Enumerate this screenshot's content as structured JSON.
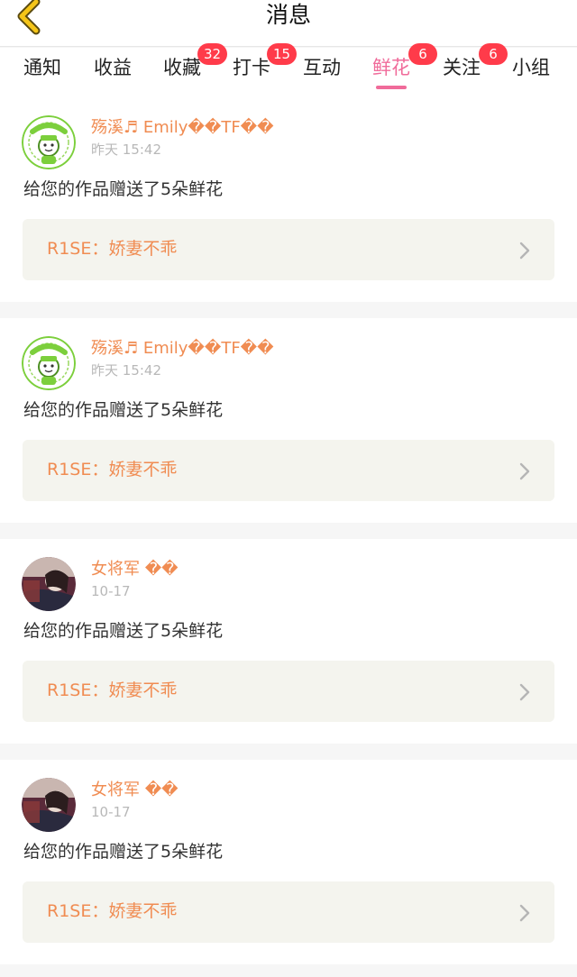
{
  "header": {
    "title": "消息",
    "back_icon": "chevron-left-icon"
  },
  "colors": {
    "accent_pink": "#f06b9a",
    "badge_red": "#ff3b4a",
    "name_orange": "#f08c52",
    "back_yellow": "#f5c518",
    "work_bg": "#f4f4ee"
  },
  "tabs": [
    {
      "label": "通知",
      "badge": ""
    },
    {
      "label": "收益",
      "badge": ""
    },
    {
      "label": "收藏",
      "badge": "32"
    },
    {
      "label": "打卡",
      "badge": "15"
    },
    {
      "label": "互动",
      "badge": ""
    },
    {
      "label": "鲜花",
      "badge": "6",
      "active": true
    },
    {
      "label": "关注",
      "badge": "6"
    },
    {
      "label": "小组",
      "badge": ""
    }
  ],
  "messages": [
    {
      "username": "殇溪♬ Emily��TF��",
      "time": "昨天 15:42",
      "text": "给您的作品赠送了5朵鲜花",
      "work": "R1SE：娇妻不乖",
      "avatar": "green-cartoon-avatar"
    },
    {
      "username": "殇溪♬ Emily��TF��",
      "time": "昨天 15:42",
      "text": "给您的作品赠送了5朵鲜花",
      "work": "R1SE：娇妻不乖",
      "avatar": "green-cartoon-avatar"
    },
    {
      "username": "女将军 ��",
      "time": "10-17",
      "text": "给您的作品赠送了5朵鲜花",
      "work": "R1SE：娇妻不乖",
      "avatar": "photo-avatar"
    },
    {
      "username": "女将军 ��",
      "time": "10-17",
      "text": "给您的作品赠送了5朵鲜花",
      "work": "R1SE：娇妻不乖",
      "avatar": "photo-avatar"
    }
  ]
}
